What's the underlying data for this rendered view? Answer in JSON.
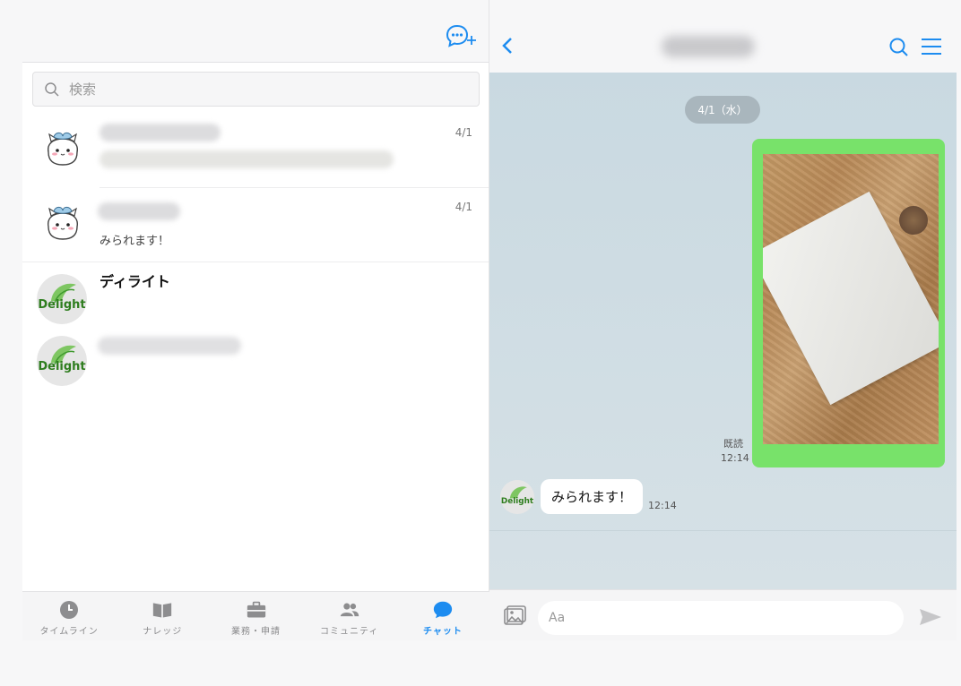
{
  "left": {
    "search": {
      "placeholder": "検索"
    },
    "chats": [
      {
        "name": "",
        "preview": "",
        "date": "4/1",
        "avatar": "cat-avatar"
      },
      {
        "name": "",
        "preview": "みられます！",
        "date": "4/1",
        "avatar": "cat-avatar"
      },
      {
        "name": "ディライト",
        "preview": "",
        "date": "",
        "avatar": "delight-logo"
      },
      {
        "name": "",
        "preview": "",
        "date": "",
        "avatar": "delight-logo"
      }
    ],
    "tabs": [
      {
        "label": "タイムライン",
        "icon": "clock-icon"
      },
      {
        "label": "ナレッジ",
        "icon": "book-icon"
      },
      {
        "label": "業務・申請",
        "icon": "briefcase-icon"
      },
      {
        "label": "コミュニティ",
        "icon": "people-icon"
      },
      {
        "label": "チャット",
        "icon": "chat-icon"
      }
    ],
    "active_tab": 4
  },
  "right": {
    "date_pill": "4/1（水）",
    "read_label": "既読",
    "sent_time": "12:14",
    "received_message": "みられます！",
    "received_time": "12:14",
    "input_placeholder": "Aa"
  },
  "logo_text": "Delight",
  "colors": {
    "accent": "#1d8cf0",
    "sent_bubble": "#78e26a",
    "chat_bg": "#d3dde3"
  }
}
